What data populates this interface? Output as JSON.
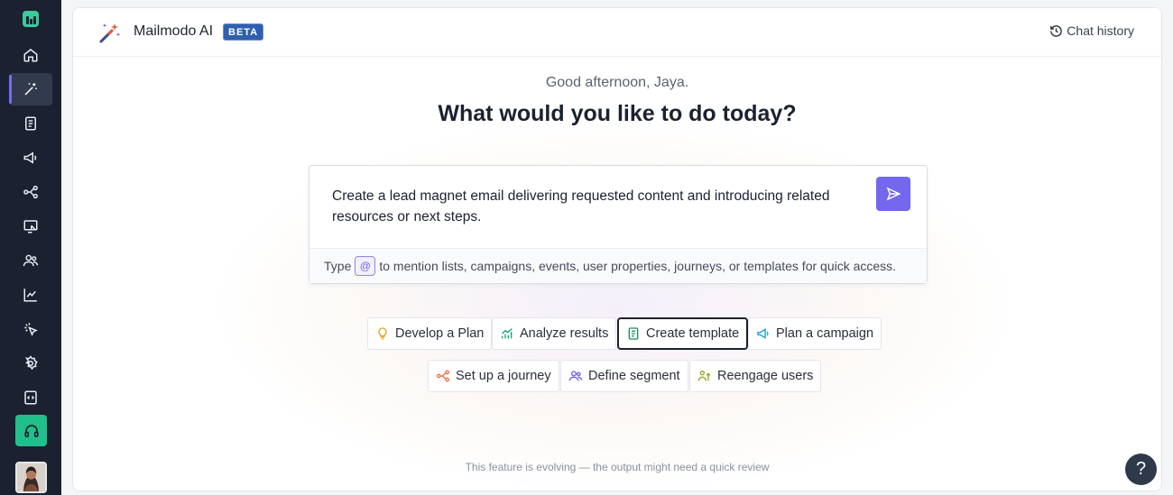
{
  "sidebar": {
    "items": [
      {
        "name": "home-icon",
        "active": false
      },
      {
        "name": "magic-wand-icon",
        "active": true
      },
      {
        "name": "document-icon",
        "active": false
      },
      {
        "name": "megaphone-icon",
        "active": false
      },
      {
        "name": "journey-icon",
        "active": false
      },
      {
        "name": "screen-cursor-icon",
        "active": false
      },
      {
        "name": "users-icon",
        "active": false
      },
      {
        "name": "analytics-icon",
        "active": false
      },
      {
        "name": "click-icon",
        "active": false
      },
      {
        "name": "settings-icon",
        "active": false
      },
      {
        "name": "code-icon",
        "active": false
      }
    ],
    "support_icon": "headphones-icon",
    "accent": "#21c08b"
  },
  "header": {
    "app_name": "Mailmodo AI",
    "badge": "BETA",
    "chat_history_label": "Chat history"
  },
  "main": {
    "greeting": "Good afternoon, Jaya.",
    "headline": "What would you like to do today?",
    "prompt": {
      "text": "Create a lead magnet email delivering requested content and introducing related resources or next steps.",
      "hint_before": "Type",
      "hint_symbol": "@",
      "hint_after": "to mention lists, campaigns, events, user properties, journeys, or templates for quick access."
    },
    "actions": [
      {
        "label": "Develop a Plan",
        "icon": "lightbulb-icon",
        "selected": false
      },
      {
        "label": "Analyze results",
        "icon": "chart-icon",
        "selected": false
      },
      {
        "label": "Create template",
        "icon": "template-icon",
        "selected": true
      },
      {
        "label": "Plan a campaign",
        "icon": "megaphone-icon",
        "selected": false
      },
      {
        "label": "Set up a journey",
        "icon": "journey-icon",
        "selected": false
      },
      {
        "label": "Define segment",
        "icon": "segment-icon",
        "selected": false
      },
      {
        "label": "Reengage users",
        "icon": "reengage-icon",
        "selected": false
      }
    ],
    "disclaimer": "This feature is evolving — the output might need a quick review"
  },
  "help_label": "?",
  "colors": {
    "sidebar_bg": "#1b2130",
    "send_button": "#7567ee",
    "beta_badge": "#2f5fae"
  }
}
